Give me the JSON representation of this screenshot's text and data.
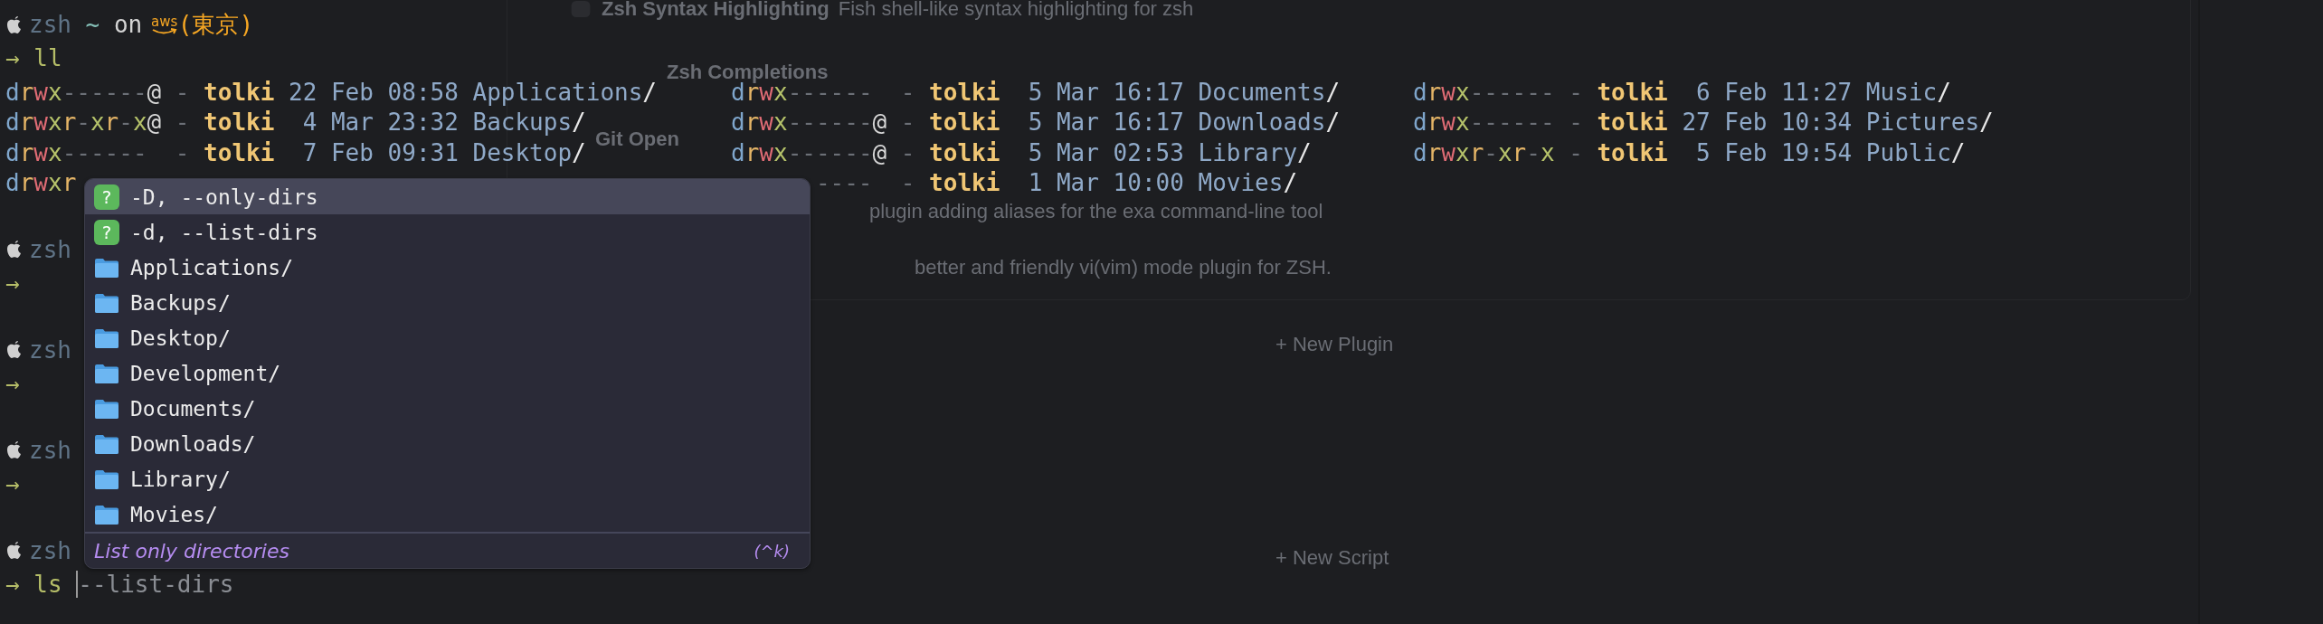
{
  "background_app": {
    "plugins": [
      {
        "title": "Zsh Syntax Highlighting",
        "description": "Fish shell-like syntax highlighting for zsh"
      },
      {
        "title": "Zsh Completions"
      },
      {
        "title": "Git Open"
      },
      {
        "description": "plugin adding aliases for the exa command-line tool"
      },
      {
        "description": "better and friendly vi(vim) mode plugin for ZSH."
      }
    ],
    "new_plugin": "+ New Plugin",
    "new_script": "+ New Script"
  },
  "terminal": {
    "blocks": [
      {
        "prompt": {
          "shell": "zsh",
          "dir": "~",
          "connector": "on",
          "cloud": "aws",
          "region": "(東京)"
        },
        "command": {
          "arrow": "→",
          "text": "ll"
        },
        "listing": [
          [
            {
              "perms": [
                {
                  "kind": "type",
                  "text": "d"
                },
                {
                  "kind": "read",
                  "text": "r"
                },
                {
                  "kind": "write",
                  "text": "w"
                },
                {
                  "kind": "exec",
                  "text": "x"
                },
                {
                  "kind": "none",
                  "text": "------"
                }
              ],
              "attr": "@",
              "link": "-",
              "user": "tolki",
              "day": "22",
              "month": "Feb",
              "time": "08:58",
              "name": "Applications",
              "slash": "/"
            },
            {
              "perms": [
                {
                  "kind": "type",
                  "text": "d"
                },
                {
                  "kind": "read",
                  "text": "r"
                },
                {
                  "kind": "write",
                  "text": "w"
                },
                {
                  "kind": "exec",
                  "text": "x"
                },
                {
                  "kind": "read",
                  "text": "r"
                },
                {
                  "kind": "none",
                  "text": "-"
                },
                {
                  "kind": "exec",
                  "text": "x"
                },
                {
                  "kind": "read",
                  "text": "r"
                },
                {
                  "kind": "none",
                  "text": "-"
                },
                {
                  "kind": "exec",
                  "text": "x"
                }
              ],
              "attr": "@",
              "link": "-",
              "user": "tolki",
              "day": "4",
              "month": "Mar",
              "time": "23:32",
              "name": "Backups",
              "slash": "/"
            },
            {
              "perms": [
                {
                  "kind": "type",
                  "text": "d"
                },
                {
                  "kind": "read",
                  "text": "r"
                },
                {
                  "kind": "write",
                  "text": "w"
                },
                {
                  "kind": "exec",
                  "text": "x"
                },
                {
                  "kind": "none",
                  "text": "------"
                }
              ],
              "link": "-",
              "user": "tolki",
              "day": "7",
              "month": "Feb",
              "time": "09:31",
              "name": "Desktop",
              "slash": "/"
            },
            {
              "perms": [
                {
                  "kind": "type",
                  "text": "d"
                },
                {
                  "kind": "read",
                  "text": "r"
                },
                {
                  "kind": "write",
                  "text": "w"
                },
                {
                  "kind": "exec",
                  "text": "x"
                },
                {
                  "kind": "read",
                  "text": "r"
                }
              ]
            }
          ],
          [
            {
              "perms": [
                {
                  "kind": "type",
                  "text": "d"
                },
                {
                  "kind": "read",
                  "text": "r"
                },
                {
                  "kind": "write",
                  "text": "w"
                },
                {
                  "kind": "exec",
                  "text": "x"
                },
                {
                  "kind": "none",
                  "text": "------"
                }
              ],
              "link": "-",
              "user": "tolki",
              "day": "5",
              "month": "Mar",
              "time": "16:17",
              "name": "Documents",
              "slash": "/"
            },
            {
              "perms": [
                {
                  "kind": "type",
                  "text": "d"
                },
                {
                  "kind": "read",
                  "text": "r"
                },
                {
                  "kind": "write",
                  "text": "w"
                },
                {
                  "kind": "exec",
                  "text": "x"
                },
                {
                  "kind": "none",
                  "text": "------"
                }
              ],
              "attr": "@",
              "link": "-",
              "user": "tolki",
              "day": "5",
              "month": "Mar",
              "time": "16:17",
              "name": "Downloads",
              "slash": "/"
            },
            {
              "perms": [
                {
                  "kind": "type",
                  "text": "d"
                },
                {
                  "kind": "read",
                  "text": "r"
                },
                {
                  "kind": "write",
                  "text": "w"
                },
                {
                  "kind": "exec",
                  "text": "x"
                },
                {
                  "kind": "none",
                  "text": "------"
                }
              ],
              "attr": "@",
              "link": "-",
              "user": "tolki",
              "day": "5",
              "month": "Mar",
              "time": "02:53",
              "name": "Library",
              "slash": "/"
            },
            {
              "perms": [
                {
                  "kind": "none",
                  "text": "----"
                }
              ],
              "link": "-",
              "user": "tolki",
              "day": "1",
              "month": "Mar",
              "time": "10:00",
              "name": "Movies",
              "slash": "/"
            }
          ],
          [
            {
              "perms": [
                {
                  "kind": "type",
                  "text": "d"
                },
                {
                  "kind": "read",
                  "text": "r"
                },
                {
                  "kind": "write",
                  "text": "w"
                },
                {
                  "kind": "exec",
                  "text": "x"
                },
                {
                  "kind": "none",
                  "text": "------"
                }
              ],
              "link": "-",
              "user": "tolki",
              "day": "6",
              "month": "Feb",
              "time": "11:27",
              "name": "Music",
              "slash": "/"
            },
            {
              "perms": [
                {
                  "kind": "type",
                  "text": "d"
                },
                {
                  "kind": "read",
                  "text": "r"
                },
                {
                  "kind": "write",
                  "text": "w"
                },
                {
                  "kind": "exec",
                  "text": "x"
                },
                {
                  "kind": "none",
                  "text": "------"
                }
              ],
              "link": "-",
              "user": "tolki",
              "day": "27",
              "month": "Feb",
              "time": "10:34",
              "name": "Pictures",
              "slash": "/"
            },
            {
              "perms": [
                {
                  "kind": "type",
                  "text": "d"
                },
                {
                  "kind": "read",
                  "text": "r"
                },
                {
                  "kind": "write",
                  "text": "w"
                },
                {
                  "kind": "exec",
                  "text": "x"
                },
                {
                  "kind": "read",
                  "text": "r"
                },
                {
                  "kind": "none",
                  "text": "-"
                },
                {
                  "kind": "exec",
                  "text": "x"
                },
                {
                  "kind": "read",
                  "text": "r"
                },
                {
                  "kind": "none",
                  "text": "-"
                },
                {
                  "kind": "exec",
                  "text": "x"
                }
              ],
              "link": "-",
              "user": "tolki",
              "day": "5",
              "month": "Feb",
              "time": "19:54",
              "name": "Public",
              "slash": "/"
            }
          ]
        ]
      },
      {
        "prompt": {
          "shell": "zsh"
        },
        "command": {
          "arrow": "→"
        }
      },
      {
        "prompt": {
          "shell": "zsh"
        },
        "command": {
          "arrow": "→"
        }
      },
      {
        "prompt": {
          "shell": "zsh"
        },
        "command": {
          "arrow": "→"
        }
      },
      {
        "prompt": {
          "shell": "zsh"
        },
        "command": {
          "arrow": "→",
          "text": "ls",
          "suggestion": "--list-dirs"
        }
      }
    ]
  },
  "completion_menu": {
    "items": [
      {
        "kind": "option",
        "badge": "?",
        "label": "-D, --only-dirs",
        "selected": true
      },
      {
        "kind": "option",
        "badge": "?",
        "label": "-d, --list-dirs",
        "selected": false
      },
      {
        "kind": "folder",
        "label": "Applications/",
        "selected": false
      },
      {
        "kind": "folder",
        "label": "Backups/",
        "selected": false
      },
      {
        "kind": "folder",
        "label": "Desktop/",
        "selected": false
      },
      {
        "kind": "folder",
        "label": "Development/",
        "selected": false
      },
      {
        "kind": "folder",
        "label": "Documents/",
        "selected": false
      },
      {
        "kind": "folder",
        "label": "Downloads/",
        "selected": false
      },
      {
        "kind": "folder",
        "label": "Library/",
        "selected": false
      },
      {
        "kind": "folder",
        "label": "Movies/",
        "selected": false
      }
    ],
    "description": "List only directories",
    "shortcut": "(^k)"
  }
}
